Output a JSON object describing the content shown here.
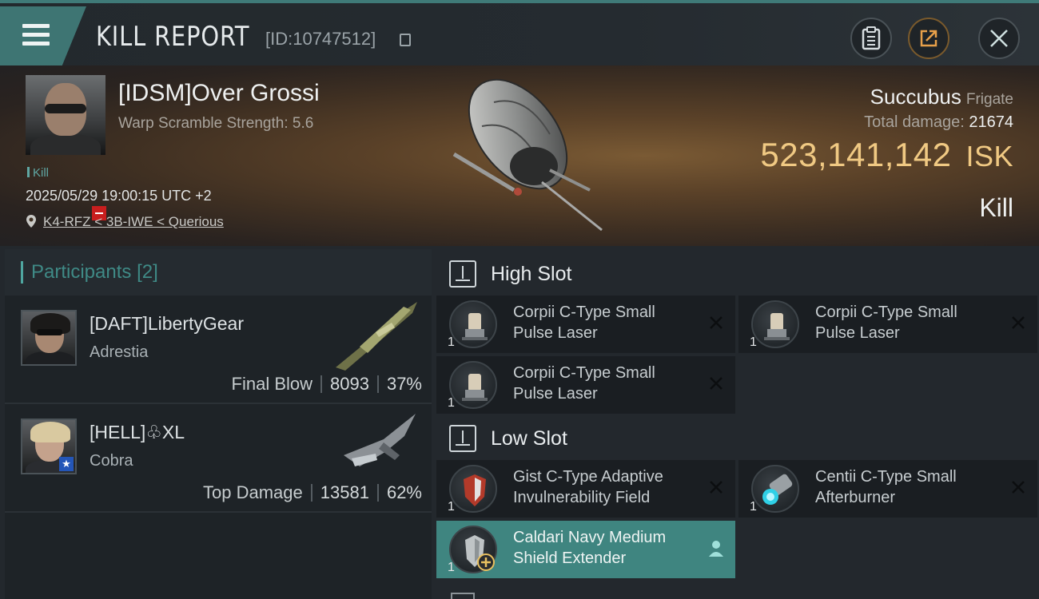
{
  "header": {
    "title": "KILL REPORT",
    "kill_id": "[ID:10747512]"
  },
  "victim": {
    "name": "[IDSM]Over Grossi",
    "warp_scramble": "Warp Scramble Strength: 5.6",
    "kill_tag": "Kill",
    "datetime": "2025/05/29 19:00:15 UTC +2",
    "location": "K4-RFZ < 3B-IWE < Querious",
    "ship_name": "Succubus",
    "ship_class": "Frigate",
    "total_damage_label": "Total damage:",
    "total_damage_value": "21674",
    "isk_value": "523,141,142",
    "isk_unit": "ISK",
    "result": "Kill"
  },
  "participants": {
    "title": "Participants",
    "count": "[2]",
    "items": [
      {
        "name": "[DAFT]LibertyGear",
        "ship": "Adrestia",
        "role": "Final Blow",
        "damage": "8093",
        "percent": "37%"
      },
      {
        "name": "[HELL]♧XL",
        "ship": "Cobra",
        "role": "Top Damage",
        "damage": "13581",
        "percent": "62%"
      }
    ]
  },
  "fitting": {
    "high_slot_label": "High Slot",
    "low_slot_label": "Low Slot",
    "high_slot": [
      {
        "name": "Corpii C-Type Small Pulse Laser",
        "qty": "1"
      },
      {
        "name": "Corpii C-Type Small Pulse Laser",
        "qty": "1"
      },
      {
        "name": "Corpii C-Type Small Pulse Laser",
        "qty": "1"
      }
    ],
    "low_slot": [
      {
        "name": "Gist C-Type Adaptive Invulnerability Field",
        "qty": "1"
      },
      {
        "name": "Centii C-Type Small Afterburner",
        "qty": "1"
      },
      {
        "name": "Caldari Navy Medium Shield Extender",
        "qty": "1"
      }
    ]
  },
  "colors": {
    "accent": "#3f8580",
    "isk_gold": "#f0c983",
    "danger": "#c81e1e"
  }
}
